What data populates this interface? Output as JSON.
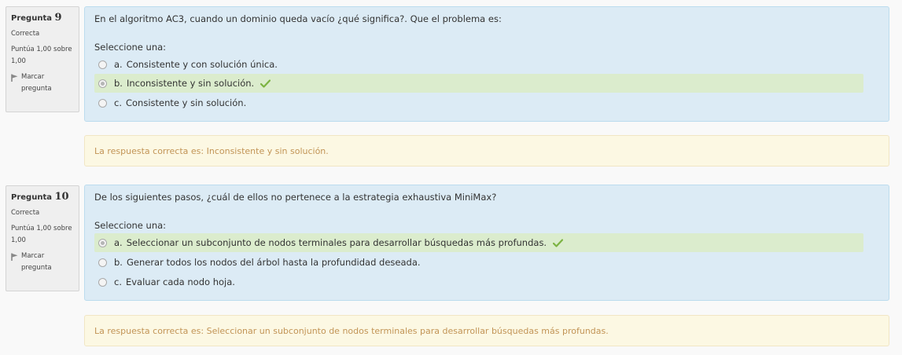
{
  "questions": [
    {
      "label": "Pregunta",
      "number": "9",
      "state": "Correcta",
      "grade_line1": "Puntúa 1,00 sobre",
      "grade_line2": "1,00",
      "flag_line1": "Marcar",
      "flag_line2": "pregunta",
      "text": "En el algoritmo AC3, cuando un dominio queda vacío ¿qué significa?. Que el problema es:",
      "prompt": "Seleccione una:",
      "options": [
        {
          "letter": "a.",
          "text": "Consistente y con solución única.",
          "selected": false,
          "correct": false
        },
        {
          "letter": "b.",
          "text": "Inconsistente y sin solución.",
          "selected": true,
          "correct": true
        },
        {
          "letter": "c.",
          "text": "Consistente y sin solución.",
          "selected": false,
          "correct": false
        }
      ],
      "right_answer": "La respuesta correcta es:  Inconsistente y sin solución."
    },
    {
      "label": "Pregunta",
      "number": "10",
      "state": "Correcta",
      "grade_line1": "Puntúa 1,00 sobre",
      "grade_line2": "1,00",
      "flag_line1": "Marcar",
      "flag_line2": "pregunta",
      "text": "De los siguientes pasos, ¿cuál de ellos no pertenece a la estrategia exhaustiva MiniMax?",
      "prompt": "Seleccione una:",
      "options": [
        {
          "letter": "a.",
          "text": "Seleccionar un subconjunto de nodos terminales para desarrollar búsquedas más profundas.",
          "selected": true,
          "correct": true
        },
        {
          "letter": "b.",
          "text": "Generar todos los nodos del árbol hasta la profundidad deseada.",
          "selected": false,
          "correct": false
        },
        {
          "letter": "c.",
          "text": "Evaluar cada nodo hoja.",
          "selected": false,
          "correct": false
        }
      ],
      "right_answer": "La respuesta correcta es: Seleccionar un subconjunto de nodos terminales para desarrollar búsquedas más profundas."
    }
  ],
  "colors": {
    "formulation_bg": "#dcebf5",
    "correct_option_bg": "#dbeccd",
    "outcome_bg": "#fcf8e3",
    "outcome_text": "#c29456",
    "check": "#7cb342"
  }
}
